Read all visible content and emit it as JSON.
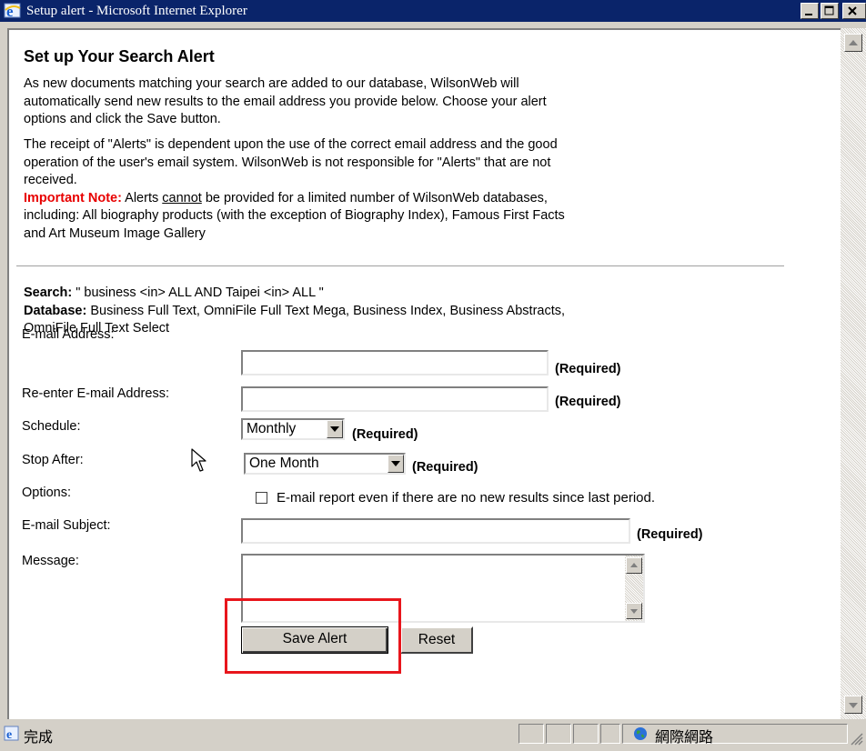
{
  "window": {
    "title": "Setup alert - Microsoft Internet Explorer"
  },
  "page": {
    "heading": "Set up Your Search Alert",
    "intro_line1": "As new documents matching your search are added to our database, WilsonWeb will",
    "intro_line2": "automatically send new results to the email address you provide below. Choose your alert",
    "intro_line3": "options and click the Save button.",
    "receipt_line1": "The receipt of \"Alerts\" is dependent upon the use of the correct email address and the good",
    "receipt_line2": "operation of the user's email system. WilsonWeb is not responsible for \"Alerts\" that are not",
    "receipt_line3": "received.",
    "important_label": "Important Note:",
    "important_pre": " Alerts ",
    "important_cannot": "cannot",
    "important_post": " be provided for a limited number of WilsonWeb databases,",
    "important_line2": "including: All biography products (with the exception of Biography Index), Famous First Facts",
    "important_line3": "and Art Museum Image Gallery"
  },
  "search": {
    "label": "Search:",
    "query": " \" business <in> ALL AND Taipei <in> ALL \"",
    "database_label": "Database:",
    "databases_line1": " Business Full Text, OmniFile Full Text Mega, Business Index, Business Abstracts,",
    "databases_line2": "OmniFile Full Text Select"
  },
  "form": {
    "email_label": "E-mail Address:",
    "email_value": "",
    "reenter_label": "Re-enter E-mail Address:",
    "reenter_value": "",
    "schedule_label": "Schedule:",
    "schedule_value": "Monthly",
    "stop_label": "Stop After:",
    "stop_value": "One Month",
    "options_label": "Options:",
    "options_checkbox_label": "E-mail report even if there are no new results since last period.",
    "options_checked": false,
    "subject_label": "E-mail Subject:",
    "subject_value": "",
    "message_label": "Message:",
    "message_value": "",
    "required_text": "(Required)",
    "save_button": "Save Alert",
    "reset_button": "Reset"
  },
  "status": {
    "left_text": "完成",
    "zone_text": "網際網路"
  },
  "colors": {
    "titlebar": "#0a246a",
    "important": "#e80000",
    "highlight_box": "#e8161c",
    "chrome": "#d4d0c8"
  },
  "icons": [
    "ie-icon",
    "minimize-icon",
    "maximize-icon",
    "close-icon",
    "scroll-up-icon",
    "scroll-down-icon",
    "dropdown-arrow-icon",
    "mouse-cursor-icon",
    "globe-icon"
  ]
}
